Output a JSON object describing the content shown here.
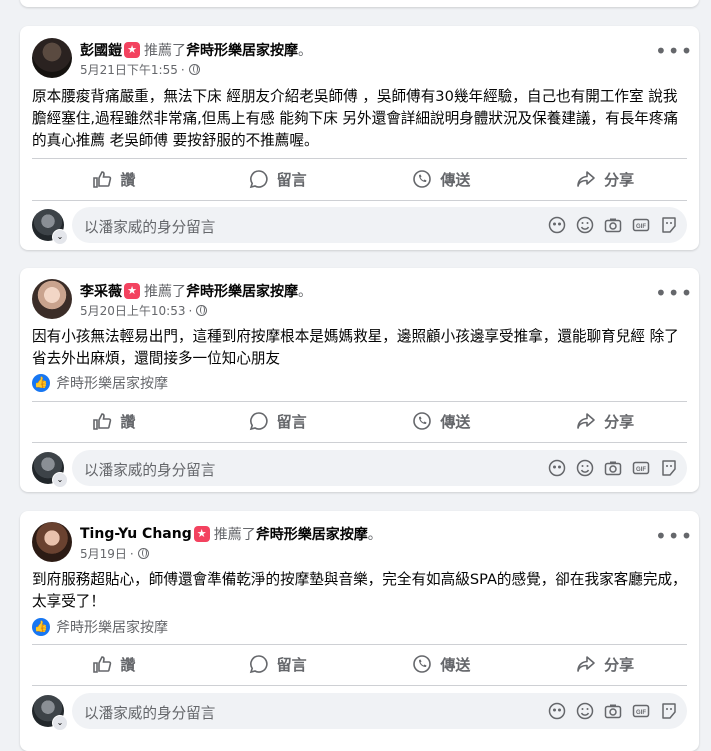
{
  "posts": [
    {
      "author": "彭國鎧",
      "recommended": "推薦了",
      "page": "斧時形樂居家按摩",
      "date": "5月21日下午1:55",
      "text": "原本腰痠背痛嚴重，無法下床 經朋友介紹老吳師傅 ，吳師傅有30幾年經驗，自己也有開工作室 說我膽經塞住,過程雖然非常痛,但馬上有感  能夠下床 另外還會詳細說明身體狀況及保養建議，有長年疼痛的真心推薦  老吳師傅 要按舒服的不推薦喔。",
      "page_tag": ""
    },
    {
      "author": "李采薇",
      "recommended": "推薦了",
      "page": "斧時形樂居家按摩",
      "date": "5月20日上午10:53",
      "text": "因有小孩無法輕易出門，這種到府按摩根本是媽媽救星，邊照顧小孩邊享受推拿，還能聊育兒經 除了省去外出麻煩，還間接多一位知心朋友",
      "page_tag": "斧時形樂居家按摩"
    },
    {
      "author": "Ting-Yu Chang",
      "recommended": "推薦了",
      "page": "斧時形樂居家按摩",
      "date": "5月19日",
      "text": "到府服務超貼心，師傅還會準備乾淨的按摩墊與音樂，完全有如高級SPA的感覺，卻在我家客廳完成，太享受了！",
      "page_tag": "斧時形樂居家按摩"
    }
  ],
  "actions": {
    "like": "讚",
    "comment": "留言",
    "send": "傳送",
    "share": "分享"
  },
  "comment_placeholder": "以潘家威的身分留言",
  "more_label": "•••",
  "period": "。",
  "icons": {
    "recommend": "recommend-icon",
    "globe": "globe-icon",
    "like": "thumbs-up-icon",
    "comment": "speech-bubble-icon",
    "send": "whatsapp-icon",
    "share": "share-arrow-icon",
    "avatar_sticker": "avatar-sticker-icon",
    "emoji": "emoji-icon",
    "camera": "camera-icon",
    "gif": "gif-icon",
    "sticker": "sticker-icon"
  },
  "colors": {
    "background": "#f0f2f5",
    "card": "#ffffff",
    "secondary_text": "#65676b",
    "recommend_badge": "#f3425f",
    "facebook_blue": "#1877f2"
  }
}
